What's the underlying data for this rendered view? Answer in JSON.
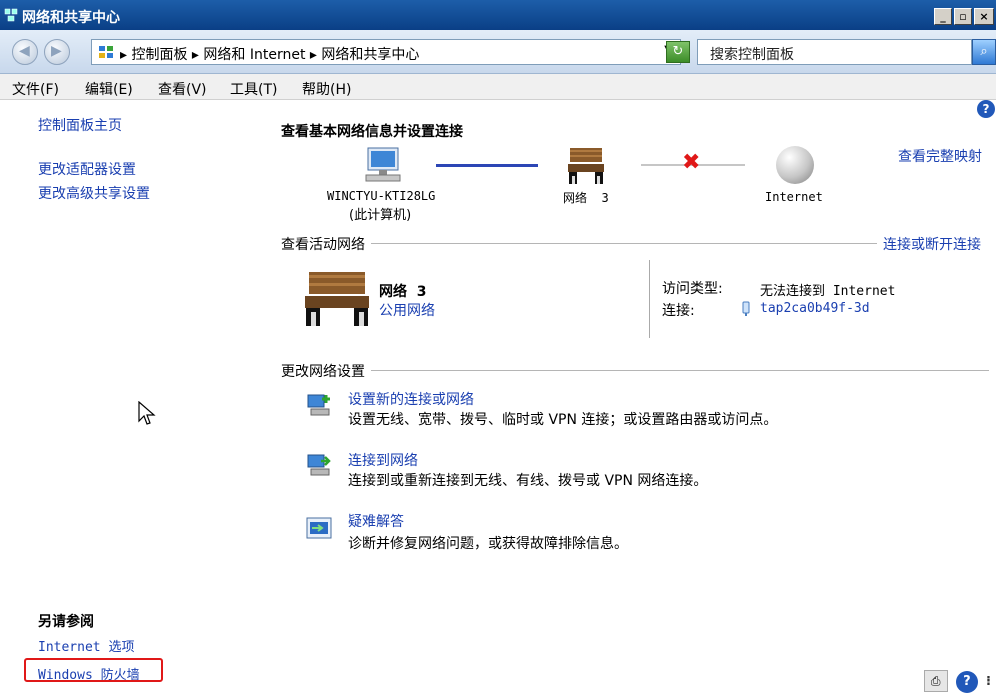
{
  "window": {
    "title": "网络和共享中心"
  },
  "address": {
    "crumbs": "▸ 控制面板 ▸ 网络和 Internet ▸ 网络和共享中心",
    "search_placeholder": "搜索控制面板"
  },
  "menu": [
    "文件(F)",
    "编辑(E)",
    "查看(V)",
    "工具(T)",
    "帮助(H)"
  ],
  "left": {
    "home": "控制面板主页",
    "links": [
      "更改适配器设置",
      "更改高级共享设置"
    ],
    "see_also_title": "另请参阅",
    "see_also": [
      "Internet 选项",
      "Windows 防火墙"
    ]
  },
  "main": {
    "heading": "查看基本网络信息并设置连接",
    "full_map": "查看完整映射",
    "map": {
      "computer_name": "WINCTYU-KTI28LG",
      "computer_sub": "(此计算机)",
      "network": "网络  3",
      "internet": "Internet"
    },
    "active_title": "查看活动网络",
    "connect_link": "连接或断开连接",
    "active": {
      "name": "网络  3",
      "type": "公用网络",
      "access_label": "访问类型:",
      "access_value": "无法连接到 Internet",
      "conn_label": "连接:",
      "conn_value": "tap2ca0b49f-3d"
    },
    "settings_title": "更改网络设置",
    "tasks": [
      {
        "title": "设置新的连接或网络",
        "desc": "设置无线、宽带、拨号、临时或 VPN 连接；或设置路由器或访问点。"
      },
      {
        "title": "连接到网络",
        "desc": "连接到或重新连接到无线、有线、拨号或 VPN 网络连接。"
      },
      {
        "title": "疑难解答",
        "desc": "诊断并修复网络问题，或获得故障排除信息。"
      }
    ]
  },
  "colors": {
    "link": "#1a3fb0",
    "highlight": "#e01818"
  }
}
